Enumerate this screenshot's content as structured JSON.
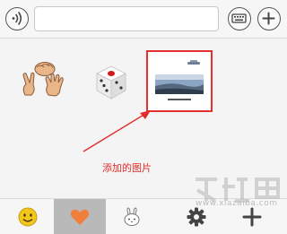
{
  "toolbar": {
    "voice_icon": "voice-wave-icon",
    "input_value": "",
    "keyboard_icon": "keyboard-icon",
    "plus_icon": "plus-icon"
  },
  "stickers": [
    {
      "name": "rock-paper-scissors",
      "icon": "hand-gestures-icon"
    },
    {
      "name": "dice",
      "icon": "dice-icon"
    },
    {
      "name": "added-image",
      "icon": "landscape-thumbnail",
      "highlighted": true,
      "highlight_color": "#e53030"
    }
  ],
  "annotation": {
    "caption": "添加的图片",
    "color": "#e32b2b"
  },
  "tabs": [
    {
      "icon": "smiley-icon",
      "selected": false
    },
    {
      "icon": "heart-icon",
      "selected": true
    },
    {
      "icon": "rabbit-icon",
      "selected": false
    },
    {
      "icon": "gear-icon",
      "selected": false
    },
    {
      "icon": "plus-icon",
      "selected": false
    }
  ],
  "watermark": {
    "text": "www.xiazaiba.com"
  }
}
